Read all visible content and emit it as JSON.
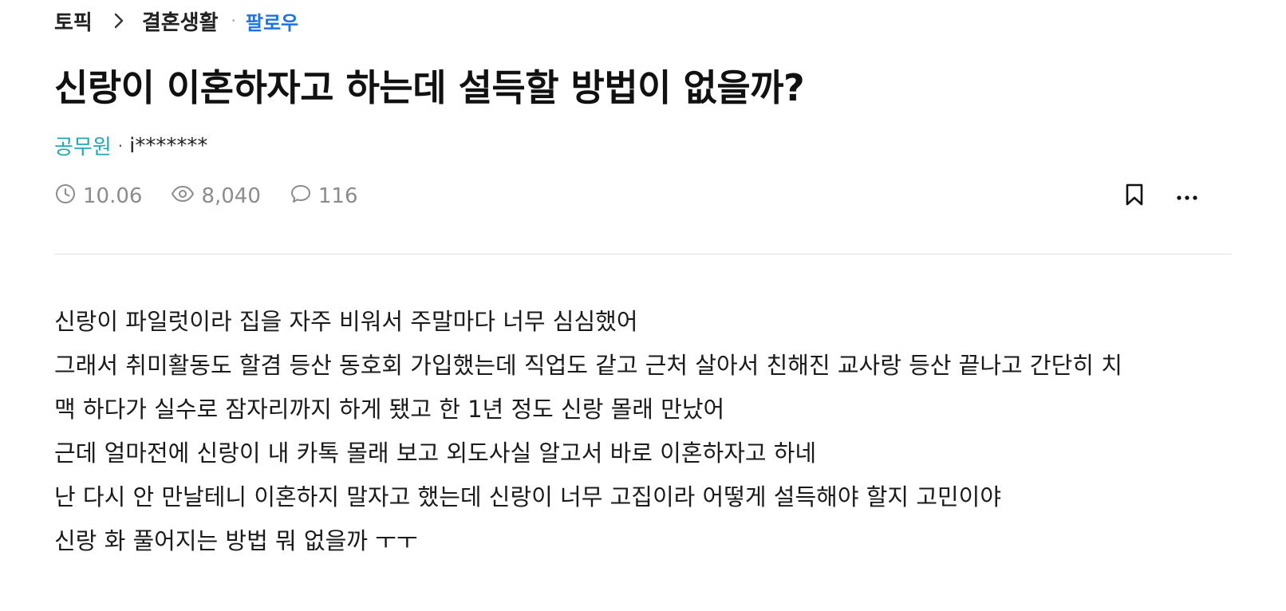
{
  "breadcrumb": {
    "root": "토픽",
    "category": "결혼생활",
    "separator": "·",
    "follow": "팔로우"
  },
  "post": {
    "title": "신랑이 이혼하자고 하는데 설득할 방법이 없을까?",
    "author_job": "공무원",
    "author_separator": "·",
    "author_id": "i*******",
    "date": "10.06",
    "views": "8,040",
    "comments": "116",
    "body_lines": [
      "신랑이 파일럿이라 집을 자주 비워서 주말마다 너무 심심했어",
      "그래서 취미활동도 할겸 등산 동호회 가입했는데 직업도 같고 근처 살아서 친해진 교사랑 등산 끝나고 간단히 치",
      "맥 하다가 실수로 잠자리까지 하게 됐고 한 1년 정도 신랑 몰래 만났어",
      "근데 얼마전에 신랑이 내 카톡 몰래 보고 외도사실 알고서 바로 이혼하자고 하네",
      "난 다시 안 만날테니 이혼하지 말자고 했는데 신랑이 너무 고집이라 어떻게 설득해야 할지 고민이야",
      "신랑 화 풀어지는 방법 뭐 없을까 ㅜㅜ"
    ]
  },
  "icons": {
    "chevron": "chevron-right-icon",
    "clock": "clock-icon",
    "views": "eye-icon",
    "comments": "speech-bubble-icon",
    "bookmark": "bookmark-icon",
    "more": "more-horizontal-icon"
  },
  "colors": {
    "accent_link": "#1a73e8",
    "author_job": "#26a6b5",
    "meta_gray": "#8c8c8c",
    "divider": "#e3e3e3"
  }
}
